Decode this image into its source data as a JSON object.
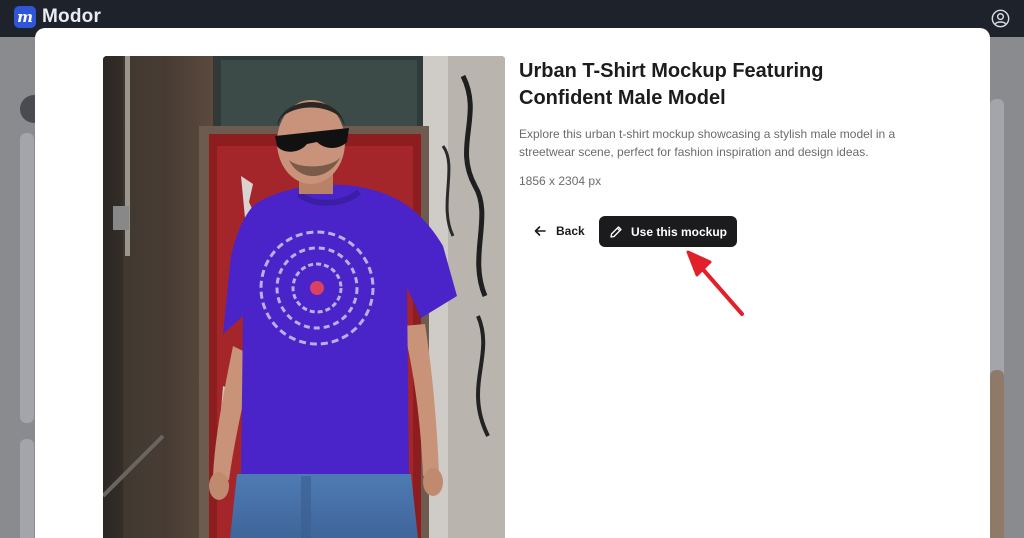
{
  "app": {
    "name": "Modor",
    "logo_letter": "m",
    "account_icon": "account-circle-icon"
  },
  "modal": {
    "title": "Urban T-Shirt Mockup Featuring Confident Male Model",
    "description": "Explore this urban t-shirt mockup showcasing a stylish male model in a streetwear scene, perfect for fashion inspiration and design ideas.",
    "dimensions": "1856 x 2304 px",
    "back_label": "Back",
    "back_icon": "arrow-left-icon",
    "use_label": "Use this mockup",
    "use_icon": "pencil-icon"
  },
  "colors": {
    "topbar": "#1d222b",
    "brand_accent": "#2f56d9",
    "primary_button": "#1b1b1d",
    "annotation_arrow": "#e1202a",
    "shirt": "#4a24c8"
  }
}
